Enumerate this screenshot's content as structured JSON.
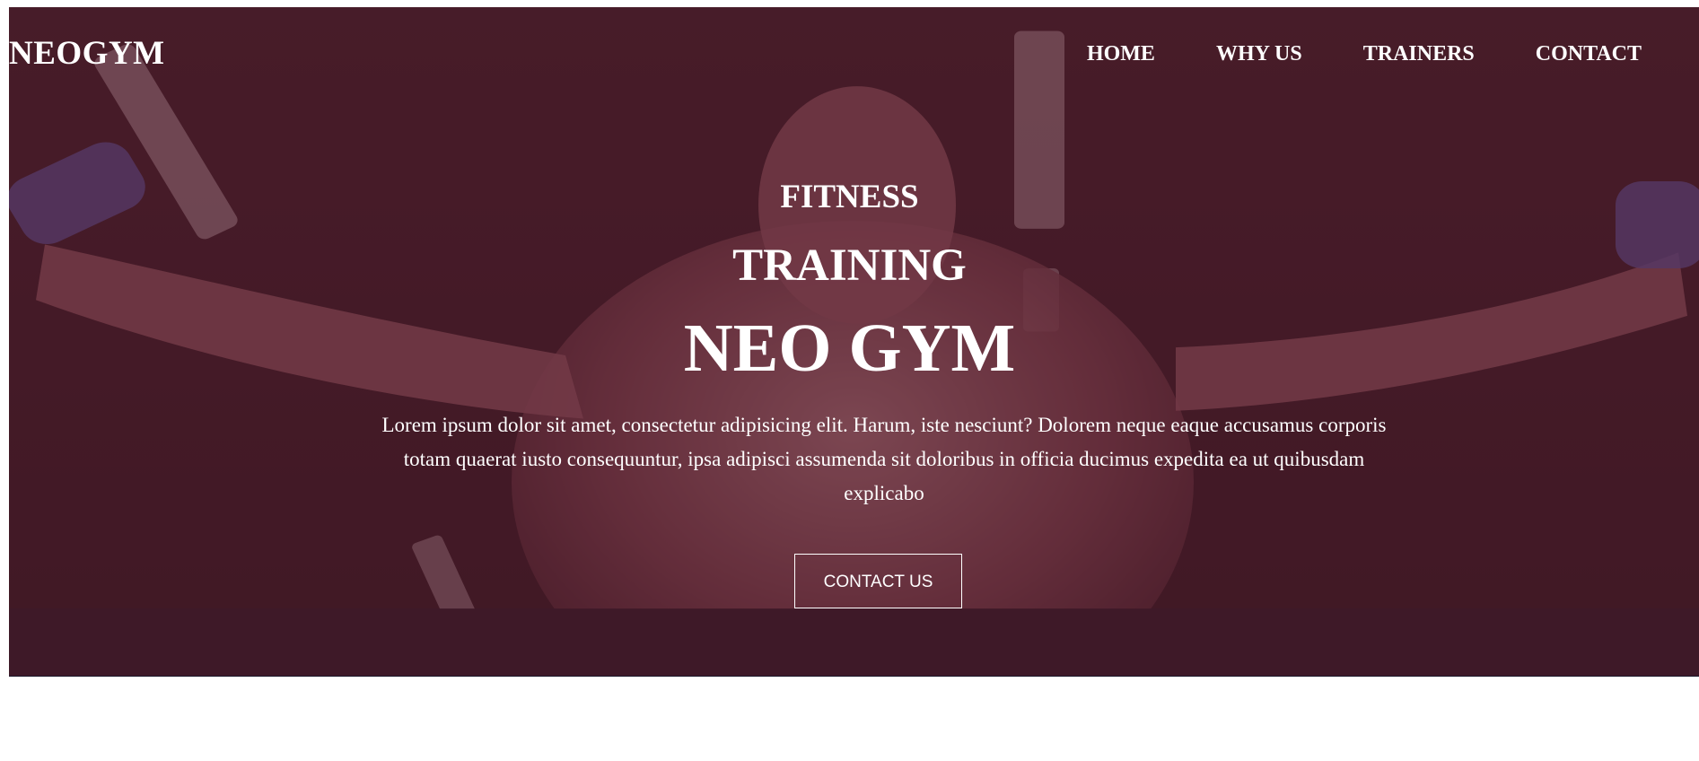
{
  "header": {
    "brand": "NEOGYM",
    "nav": [
      {
        "label": "HOME"
      },
      {
        "label": "WHY US"
      },
      {
        "label": "TRAINERS"
      },
      {
        "label": "CONTACT"
      }
    ]
  },
  "hero": {
    "subtitle_small": "FITNESS",
    "subtitle_medium": "TRAINING",
    "title": "NEO GYM",
    "description": "Lorem ipsum dolor sit amet, consectetur adipisicing elit. Harum, iste nesciunt? Dolorem neque eaque accusamus corporis totam quaerat iusto consequuntur, ipsa adipisci assumenda sit doloribus in officia ducimus expedita ea ut quibusdam explicabo",
    "cta_label": "CONTACT US",
    "background_image": "man-lifting-cable-handles-photo"
  },
  "colors": {
    "overlay_primary": "#5c1e30",
    "overlay_footer": "#1e1a2e",
    "text": "#ffffff"
  }
}
